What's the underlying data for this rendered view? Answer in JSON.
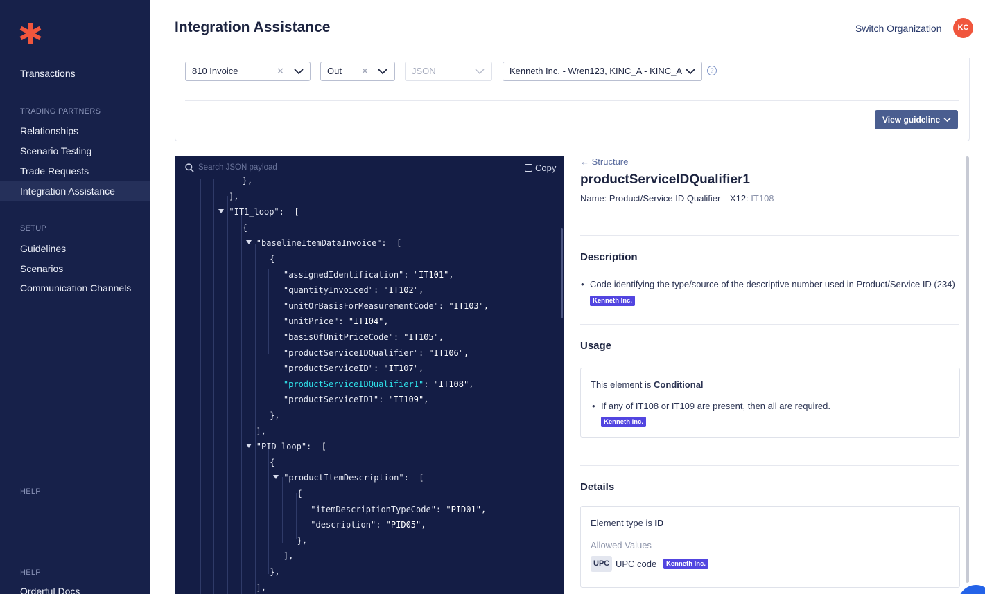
{
  "sidebar": {
    "logo": "orderful-asterisk-logo",
    "items": [
      {
        "label": "Transactions"
      },
      {
        "label": "Relationships"
      },
      {
        "label": "Scenario Testing"
      },
      {
        "label": "Trade Requests"
      },
      {
        "label": "Integration Assistance"
      },
      {
        "label": "Guidelines"
      },
      {
        "label": "Scenarios"
      },
      {
        "label": "Communication Channels"
      },
      {
        "label": "Orderful Docs"
      }
    ],
    "sections": {
      "trading_partners": "TRADING PARTNERS",
      "setup": "SETUP",
      "help1": "HELP",
      "help2": "HELP"
    },
    "active": "Integration Assistance"
  },
  "header": {
    "title": "Integration Assistance",
    "switch_org": "Switch Organization",
    "avatar_initials": "KC"
  },
  "filters": {
    "transaction": "810 Invoice",
    "direction": "Out",
    "format": "JSON",
    "partner": "Kenneth Inc. - Wren123, KINC_A - KINC_A",
    "view_guideline": "View guideline",
    "help_symbol": "?"
  },
  "code": {
    "search_placeholder": "Search JSON payload",
    "copy_label": "Copy",
    "lines": [
      {
        "indent": 4,
        "text": "},"
      },
      {
        "indent": 3,
        "text": "],"
      },
      {
        "indent": 3,
        "toggle": true,
        "key": "\"IT1_loop\"",
        "value": "[",
        "sep": ":  "
      },
      {
        "indent": 4,
        "text": "{"
      },
      {
        "indent": 5,
        "toggle": true,
        "key": "\"baselineItemDataInvoice\"",
        "value": "[",
        "sep": ":  "
      },
      {
        "indent": 6,
        "text": "{"
      },
      {
        "indent": 7,
        "key": "\"assignedIdentification\"",
        "value": "\"IT101\","
      },
      {
        "indent": 7,
        "key": "\"quantityInvoiced\"",
        "value": "\"IT102\","
      },
      {
        "indent": 7,
        "key": "\"unitOrBasisForMeasurementCode\"",
        "value": "\"IT103\","
      },
      {
        "indent": 7,
        "key": "\"unitPrice\"",
        "value": "\"IT104\","
      },
      {
        "indent": 7,
        "key": "\"basisOfUnitPriceCode\"",
        "value": "\"IT105\","
      },
      {
        "indent": 7,
        "key": "\"productServiceIDQualifier\"",
        "value": "\"IT106\","
      },
      {
        "indent": 7,
        "key": "\"productServiceID\"",
        "value": "\"IT107\","
      },
      {
        "indent": 7,
        "key": "\"productServiceIDQualifier1\"",
        "value": "\"IT108\",",
        "highlight": true
      },
      {
        "indent": 7,
        "key": "\"productServiceID1\"",
        "value": "\"IT109\","
      },
      {
        "indent": 6,
        "text": "},"
      },
      {
        "indent": 5,
        "text": "],"
      },
      {
        "indent": 5,
        "toggle": true,
        "key": "\"PID_loop\"",
        "value": "[",
        "sep": ":  "
      },
      {
        "indent": 6,
        "text": "{"
      },
      {
        "indent": 7,
        "toggle": true,
        "key": "\"productItemDescription\"",
        "value": "[",
        "sep": ":  "
      },
      {
        "indent": 8,
        "text": "{"
      },
      {
        "indent": 9,
        "key": "\"itemDescriptionTypeCode\"",
        "value": "\"PID01\","
      },
      {
        "indent": 9,
        "key": "\"description\"",
        "value": "\"PID05\","
      },
      {
        "indent": 8,
        "text": "},"
      },
      {
        "indent": 7,
        "text": "],"
      },
      {
        "indent": 6,
        "text": "},"
      },
      {
        "indent": 5,
        "text": "],"
      }
    ]
  },
  "detail": {
    "back_label": "Structure",
    "element_name": "productServiceIDQualifier1",
    "name_label": "Name: Product/Service ID Qualifier",
    "x12_label": "X12:",
    "x12_value": "IT108",
    "description_title": "Description",
    "description_text": "Code identifying the type/source of the descriptive number used in Product/Service ID (234)",
    "partner_badge": "Kenneth Inc.",
    "usage_title": "Usage",
    "usage_prefix": "This element is ",
    "usage_status": "Conditional",
    "usage_rule": "If any of IT108 or IT109 are present, then all are required.",
    "details_title": "Details",
    "element_type_prefix": "Element type is ",
    "element_type": "ID",
    "allowed_values_label": "Allowed Values",
    "allowed_values": [
      {
        "code": "UPC",
        "label": "UPC code"
      }
    ]
  }
}
